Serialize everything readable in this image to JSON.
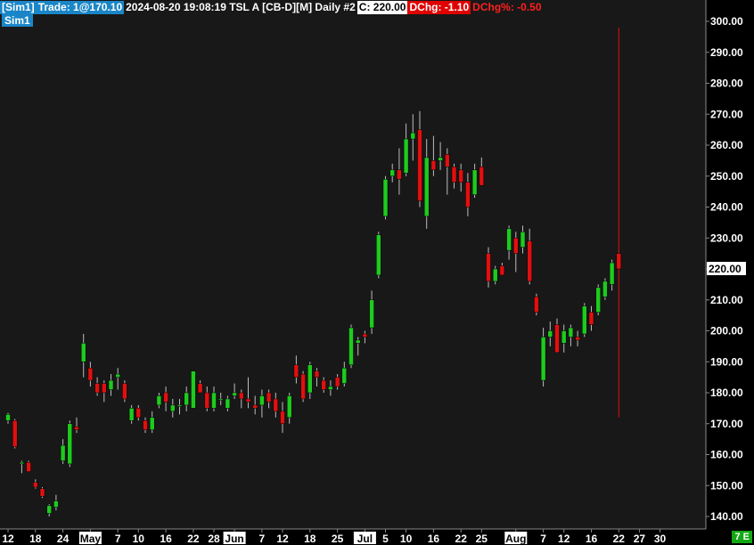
{
  "header": {
    "account": "[Sim1]",
    "trade": "Trade: 1@170.10",
    "info": "2024-08-20 19:08:19 TSL A [CB-D][M]  Daily #2",
    "close": "C: 220.00",
    "dchg": "DChg: -1.10",
    "dchg_pct": "DChg%: -0.50"
  },
  "account_badge": "Sim1",
  "timezone_badge": "7 E",
  "price_label": "220.00",
  "colors": {
    "up": "#1ecb1e",
    "down": "#e01010",
    "wick": "#bdbdbd",
    "axis_text": "#ffffff",
    "grid": "#333333",
    "bg": "#181818"
  },
  "chart_data": {
    "type": "candlestick",
    "ylim": [
      135,
      305
    ],
    "y_ticks": [
      140,
      150,
      160,
      170,
      180,
      190,
      200,
      210,
      220,
      230,
      240,
      250,
      260,
      270,
      280,
      290,
      300
    ],
    "x_ticks": [
      {
        "label": "12",
        "i": 0,
        "highlight": false
      },
      {
        "label": "18",
        "i": 4,
        "highlight": false
      },
      {
        "label": "24",
        "i": 8,
        "highlight": false
      },
      {
        "label": "May",
        "i": 12,
        "highlight": true
      },
      {
        "label": "7",
        "i": 16,
        "highlight": false
      },
      {
        "label": "10",
        "i": 19,
        "highlight": false
      },
      {
        "label": "16",
        "i": 23,
        "highlight": false
      },
      {
        "label": "22",
        "i": 27,
        "highlight": false
      },
      {
        "label": "28",
        "i": 30,
        "highlight": false
      },
      {
        "label": "Jun",
        "i": 33,
        "highlight": true
      },
      {
        "label": "7",
        "i": 37,
        "highlight": false
      },
      {
        "label": "12",
        "i": 40,
        "highlight": false
      },
      {
        "label": "18",
        "i": 44,
        "highlight": false
      },
      {
        "label": "25",
        "i": 48,
        "highlight": false
      },
      {
        "label": "Jul",
        "i": 52,
        "highlight": true
      },
      {
        "label": "5",
        "i": 55,
        "highlight": false
      },
      {
        "label": "10",
        "i": 58,
        "highlight": false
      },
      {
        "label": "16",
        "i": 62,
        "highlight": false
      },
      {
        "label": "22",
        "i": 66,
        "highlight": false
      },
      {
        "label": "25",
        "i": 69,
        "highlight": false
      },
      {
        "label": "Aug",
        "i": 74,
        "highlight": true
      },
      {
        "label": "7",
        "i": 78,
        "highlight": false
      },
      {
        "label": "12",
        "i": 81,
        "highlight": false
      },
      {
        "label": "16",
        "i": 85,
        "highlight": false
      },
      {
        "label": "22",
        "i": 89,
        "highlight": false
      },
      {
        "label": "27",
        "i": 92,
        "highlight": false
      },
      {
        "label": "30",
        "i": 95,
        "highlight": false
      }
    ],
    "candles": [
      {
        "o": 171,
        "h": 173.5,
        "l": 170,
        "c": 173
      },
      {
        "o": 171,
        "h": 171.5,
        "l": 162,
        "c": 162.5
      },
      {
        "o": 157,
        "h": 158,
        "l": 154,
        "c": 157.5
      },
      {
        "o": 157.5,
        "h": 158,
        "l": 154.5,
        "c": 154.5
      },
      {
        "o": 151,
        "h": 152,
        "l": 149,
        "c": 149.5
      },
      {
        "o": 149,
        "h": 149.5,
        "l": 146,
        "c": 146.5
      },
      {
        "o": 141,
        "h": 144,
        "l": 140,
        "c": 143.5
      },
      {
        "o": 143,
        "h": 147,
        "l": 142,
        "c": 145
      },
      {
        "o": 158,
        "h": 165,
        "l": 157,
        "c": 163
      },
      {
        "o": 157,
        "h": 171,
        "l": 156,
        "c": 170
      },
      {
        "o": 169,
        "h": 172,
        "l": 167,
        "c": 168
      },
      {
        "o": 190,
        "h": 199,
        "l": 185,
        "c": 196
      },
      {
        "o": 188,
        "h": 190,
        "l": 182,
        "c": 184
      },
      {
        "o": 183,
        "h": 185,
        "l": 179,
        "c": 180
      },
      {
        "o": 183,
        "h": 184,
        "l": 177,
        "c": 180
      },
      {
        "o": 181,
        "h": 186,
        "l": 179,
        "c": 184
      },
      {
        "o": 185,
        "h": 188,
        "l": 181,
        "c": 186
      },
      {
        "o": 183,
        "h": 184,
        "l": 177,
        "c": 178
      },
      {
        "o": 171,
        "h": 176,
        "l": 170,
        "c": 175
      },
      {
        "o": 175,
        "h": 176,
        "l": 171,
        "c": 172
      },
      {
        "o": 171,
        "h": 172,
        "l": 167,
        "c": 168
      },
      {
        "o": 168,
        "h": 174,
        "l": 167,
        "c": 172
      },
      {
        "o": 176,
        "h": 180,
        "l": 175,
        "c": 179
      },
      {
        "o": 180,
        "h": 182,
        "l": 174,
        "c": 177
      },
      {
        "o": 174,
        "h": 178,
        "l": 172,
        "c": 176
      },
      {
        "o": 176,
        "h": 178,
        "l": 173,
        "c": 176
      },
      {
        "o": 176,
        "h": 182,
        "l": 174,
        "c": 180
      },
      {
        "o": 175,
        "h": 187,
        "l": 175,
        "c": 187
      },
      {
        "o": 183,
        "h": 184,
        "l": 180,
        "c": 180
      },
      {
        "o": 180,
        "h": 182,
        "l": 174,
        "c": 175
      },
      {
        "o": 175,
        "h": 182,
        "l": 174,
        "c": 180
      },
      {
        "o": 178,
        "h": 180,
        "l": 176,
        "c": 178
      },
      {
        "o": 175,
        "h": 179,
        "l": 174,
        "c": 178
      },
      {
        "o": 179,
        "h": 183,
        "l": 178,
        "c": 180
      },
      {
        "o": 180,
        "h": 181,
        "l": 175,
        "c": 178
      },
      {
        "o": 178,
        "h": 185,
        "l": 175,
        "c": 177
      },
      {
        "o": 176,
        "h": 179,
        "l": 173,
        "c": 175
      },
      {
        "o": 176,
        "h": 181,
        "l": 172,
        "c": 179
      },
      {
        "o": 180,
        "h": 181,
        "l": 175,
        "c": 177
      },
      {
        "o": 178,
        "h": 180,
        "l": 172,
        "c": 174
      },
      {
        "o": 174,
        "h": 177,
        "l": 167,
        "c": 170
      },
      {
        "o": 172,
        "h": 180,
        "l": 170,
        "c": 179
      },
      {
        "o": 189,
        "h": 192,
        "l": 183,
        "c": 185
      },
      {
        "o": 186,
        "h": 187,
        "l": 177,
        "c": 178
      },
      {
        "o": 180,
        "h": 190,
        "l": 178,
        "c": 189
      },
      {
        "o": 187,
        "h": 188,
        "l": 182,
        "c": 185
      },
      {
        "o": 184,
        "h": 185,
        "l": 180,
        "c": 181
      },
      {
        "o": 181,
        "h": 184,
        "l": 179,
        "c": 182
      },
      {
        "o": 185,
        "h": 186,
        "l": 181,
        "c": 182
      },
      {
        "o": 183,
        "h": 190,
        "l": 182,
        "c": 188
      },
      {
        "o": 189,
        "h": 202,
        "l": 188,
        "c": 201
      },
      {
        "o": 196,
        "h": 198,
        "l": 192,
        "c": 197
      },
      {
        "o": 199,
        "h": 200,
        "l": 196,
        "c": 198
      },
      {
        "o": 201,
        "h": 213,
        "l": 199,
        "c": 210
      },
      {
        "o": 218,
        "h": 232,
        "l": 217,
        "c": 231
      },
      {
        "o": 237,
        "h": 250,
        "l": 236,
        "c": 249
      },
      {
        "o": 250,
        "h": 254,
        "l": 248,
        "c": 252
      },
      {
        "o": 252,
        "h": 259,
        "l": 244,
        "c": 249
      },
      {
        "o": 251,
        "h": 267,
        "l": 250,
        "c": 262
      },
      {
        "o": 262,
        "h": 270,
        "l": 255,
        "c": 264
      },
      {
        "o": 265,
        "h": 271,
        "l": 240,
        "c": 242
      },
      {
        "o": 237,
        "h": 262,
        "l": 233,
        "c": 256
      },
      {
        "o": 255,
        "h": 263,
        "l": 250,
        "c": 252
      },
      {
        "o": 255,
        "h": 261,
        "l": 252,
        "c": 256
      },
      {
        "o": 257,
        "h": 259,
        "l": 244,
        "c": 253
      },
      {
        "o": 253,
        "h": 254,
        "l": 246,
        "c": 248
      },
      {
        "o": 252,
        "h": 254,
        "l": 245,
        "c": 248
      },
      {
        "o": 248,
        "h": 251,
        "l": 237,
        "c": 240
      },
      {
        "o": 244,
        "h": 254,
        "l": 243,
        "c": 252
      },
      {
        "o": 253,
        "h": 256,
        "l": 247,
        "c": 247
      },
      {
        "o": 225,
        "h": 227,
        "l": 214,
        "c": 216
      },
      {
        "o": 216,
        "h": 221,
        "l": 215,
        "c": 220
      },
      {
        "o": 221,
        "h": 222,
        "l": 218,
        "c": 218
      },
      {
        "o": 226,
        "h": 234,
        "l": 223,
        "c": 233
      },
      {
        "o": 230,
        "h": 232,
        "l": 219,
        "c": 225
      },
      {
        "o": 227,
        "h": 234,
        "l": 225,
        "c": 232
      },
      {
        "o": 229,
        "h": 233,
        "l": 215,
        "c": 216
      },
      {
        "o": 211,
        "h": 212,
        "l": 205,
        "c": 206
      },
      {
        "o": 184,
        "h": 201,
        "l": 182,
        "c": 198
      },
      {
        "o": 198,
        "h": 203,
        "l": 195,
        "c": 200
      },
      {
        "o": 202,
        "h": 204,
        "l": 193,
        "c": 193
      },
      {
        "o": 196,
        "h": 202,
        "l": 193,
        "c": 200
      },
      {
        "o": 198,
        "h": 202,
        "l": 195,
        "c": 201
      },
      {
        "o": 198,
        "h": 200,
        "l": 195,
        "c": 197
      },
      {
        "o": 199,
        "h": 209,
        "l": 198,
        "c": 208
      },
      {
        "o": 206,
        "h": 208,
        "l": 200,
        "c": 202
      },
      {
        "o": 206,
        "h": 215,
        "l": 205,
        "c": 214
      },
      {
        "o": 211,
        "h": 217,
        "l": 210,
        "c": 216
      },
      {
        "o": 215,
        "h": 223,
        "l": 213,
        "c": 222
      },
      {
        "o": 225,
        "h": 298,
        "l": 172,
        "c": 220
      }
    ]
  }
}
